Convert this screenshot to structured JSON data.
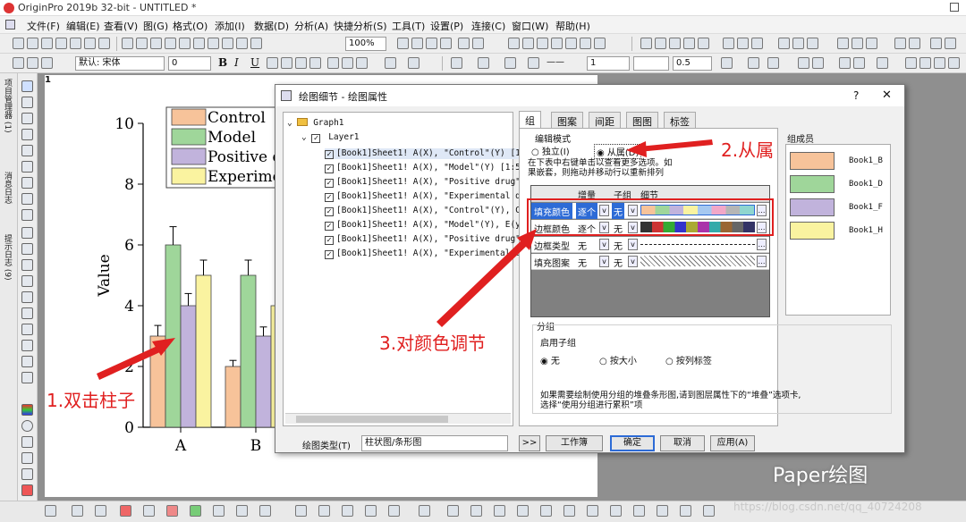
{
  "app": {
    "title": "OriginPro 2019b 32-bit - UNTITLED *",
    "menus": [
      "文件(F)",
      "编辑(E)",
      "查看(V)",
      "图(G)",
      "格式(O)",
      "添加(I)",
      "数据(D)",
      "分析(A)",
      "快捷分析(S)",
      "工具(T)",
      "设置(P)",
      "连接(C)",
      "窗口(W)",
      "帮助(H)"
    ]
  },
  "toolbar": {
    "zoom": "100%",
    "font": "默认: 宋体",
    "font_size": "0",
    "bold": "B",
    "italic": "I",
    "underline": "U",
    "line_width": "1",
    "line_width2": "0.5"
  },
  "left_panel": {
    "tab1": "项目管理器 (1)",
    "tab2": "消息日志",
    "tab3": "提示日志 (9)"
  },
  "page_number": "1",
  "chart_data": {
    "type": "bar",
    "ylabel": "Value",
    "ylim": [
      0,
      10
    ],
    "yticks": [
      "0",
      "2",
      "4",
      "6",
      "8",
      "10"
    ],
    "categories": [
      "A",
      "B"
    ],
    "series": [
      {
        "name": "Control",
        "color": "#f7c39a",
        "values": [
          3.0,
          2.0
        ],
        "errors": [
          0.35,
          0.2
        ]
      },
      {
        "name": "Model",
        "color": "#9fd69a",
        "values": [
          6.0,
          5.0
        ],
        "errors": [
          0.6,
          0.5
        ]
      },
      {
        "name": "Positive dr",
        "color": "#c1b3dc",
        "values": [
          4.0,
          3.0
        ],
        "errors": [
          0.4,
          0.3
        ]
      },
      {
        "name": "Experimen",
        "color": "#faf3a0",
        "values": [
          5.0,
          4.0
        ],
        "errors": [
          0.5,
          0.4
        ]
      }
    ]
  },
  "dialog": {
    "title": "绘图细节 - 绘图属性",
    "help": "?",
    "close": "✕",
    "tree": {
      "root": "Graph1",
      "layer": "Layer1",
      "items": [
        "[Book1]Sheet1! A(X), \"Control\"(Y) [1:5]",
        "[Book1]Sheet1! A(X), \"Model\"(Y) [1:5]",
        "[Book1]Sheet1! A(X), \"Positive drug\"(Y)",
        "[Book1]Sheet1! A(X), \"Experimental drug",
        "[Book1]Sheet1! A(X), \"Control\"(Y), C(yE",
        "[Book1]Sheet1! A(X), \"Model\"(Y), E(yEr)",
        "[Book1]Sheet1! A(X), \"Positive drug\"(Y)",
        "[Book1]Sheet1! A(X), \"Experimental drug"
      ]
    },
    "tabs": [
      "组",
      "图案",
      "间距",
      "图图",
      "标签"
    ],
    "edit_mode_label": "编辑模式",
    "radio_independent": "独立(I)",
    "radio_dependent": "从属(D)",
    "hint": "在下表中右键单击以查看更多选项。如果嵌套，则拖动并移动行以重新排列",
    "grid_headers": [
      "增量",
      "子组",
      "细节"
    ],
    "grid_rows": [
      {
        "label": "填充颜色",
        "increment": "逐个",
        "subgroup": "无"
      },
      {
        "label": "边框颜色",
        "increment": "逐个",
        "subgroup": "无"
      },
      {
        "label": "边框类型",
        "increment": "无",
        "subgroup": "无"
      },
      {
        "label": "填充图案",
        "increment": "无",
        "subgroup": "无"
      }
    ],
    "members_label": "组成员",
    "members": [
      {
        "name": "Book1_B",
        "color": "#f7c39a"
      },
      {
        "name": "Book1_D",
        "color": "#9fd69a"
      },
      {
        "name": "Book1_F",
        "color": "#c1b3dc"
      },
      {
        "name": "Book1_H",
        "color": "#faf3a0"
      }
    ],
    "grouping_label": "分组",
    "enable_subgroup": "启用子组",
    "sub_none": "无",
    "sub_by_size": "按大小",
    "sub_by_label": "按列标签",
    "stack_hint": "如果需要绘制使用分组的堆叠条形图,请到图层属性下的“堆叠”选项卡,选择“使用分组进行累积”项",
    "plot_type_label": "绘图类型(T)",
    "plot_type_value": "柱状图/条形图",
    "buttons": {
      "expand": ">>",
      "workbook": "工作簿",
      "ok": "确定",
      "cancel": "取消",
      "apply": "应用(A)"
    }
  },
  "annotations": {
    "step1": "1.双击柱子",
    "step2": "2.从属",
    "step3": "3.对颜色调节"
  },
  "watermark": "Paper绘图",
  "watermark_url": "https://blog.csdn.net/qq_40724208"
}
